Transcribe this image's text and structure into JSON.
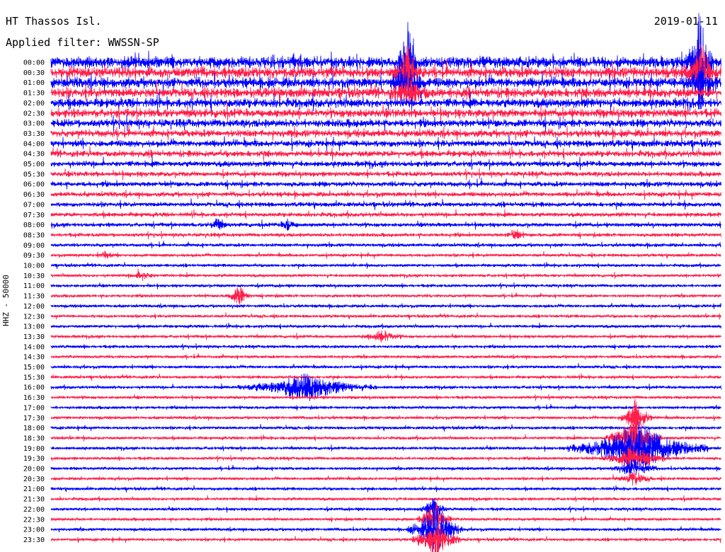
{
  "header": {
    "station": "HT Thassos Isl.",
    "date": "2019-01-11",
    "filter": "Applied filter: WWSSN-SP"
  },
  "chart_data": {
    "type": "line",
    "title": "HT Thassos Isl.",
    "date": "2019-01-11",
    "filter": "WWSSN-SP",
    "ylabel": "HHZ - 50000",
    "colors": [
      "#0000ff",
      "#ff1f4b"
    ],
    "traces": [
      "00:00",
      "00:30",
      "01:00",
      "01:30",
      "02:00",
      "02:30",
      "03:00",
      "03:30",
      "04:00",
      "04:30",
      "05:00",
      "05:30",
      "06:00",
      "06:30",
      "07:00",
      "07:30",
      "08:00",
      "08:30",
      "09:00",
      "09:30",
      "10:00",
      "10:30",
      "11:00",
      "11:30",
      "12:00",
      "12:30",
      "13:00",
      "13:30",
      "14:00",
      "14:30",
      "15:00",
      "15:30",
      "16:00",
      "16:30",
      "17:00",
      "17:30",
      "18:00",
      "18:30",
      "19:00",
      "19:30",
      "20:00",
      "20:30",
      "21:00",
      "21:30",
      "22:00",
      "22:30",
      "23:00",
      "23:30"
    ],
    "grid": false,
    "legend": "none"
  }
}
